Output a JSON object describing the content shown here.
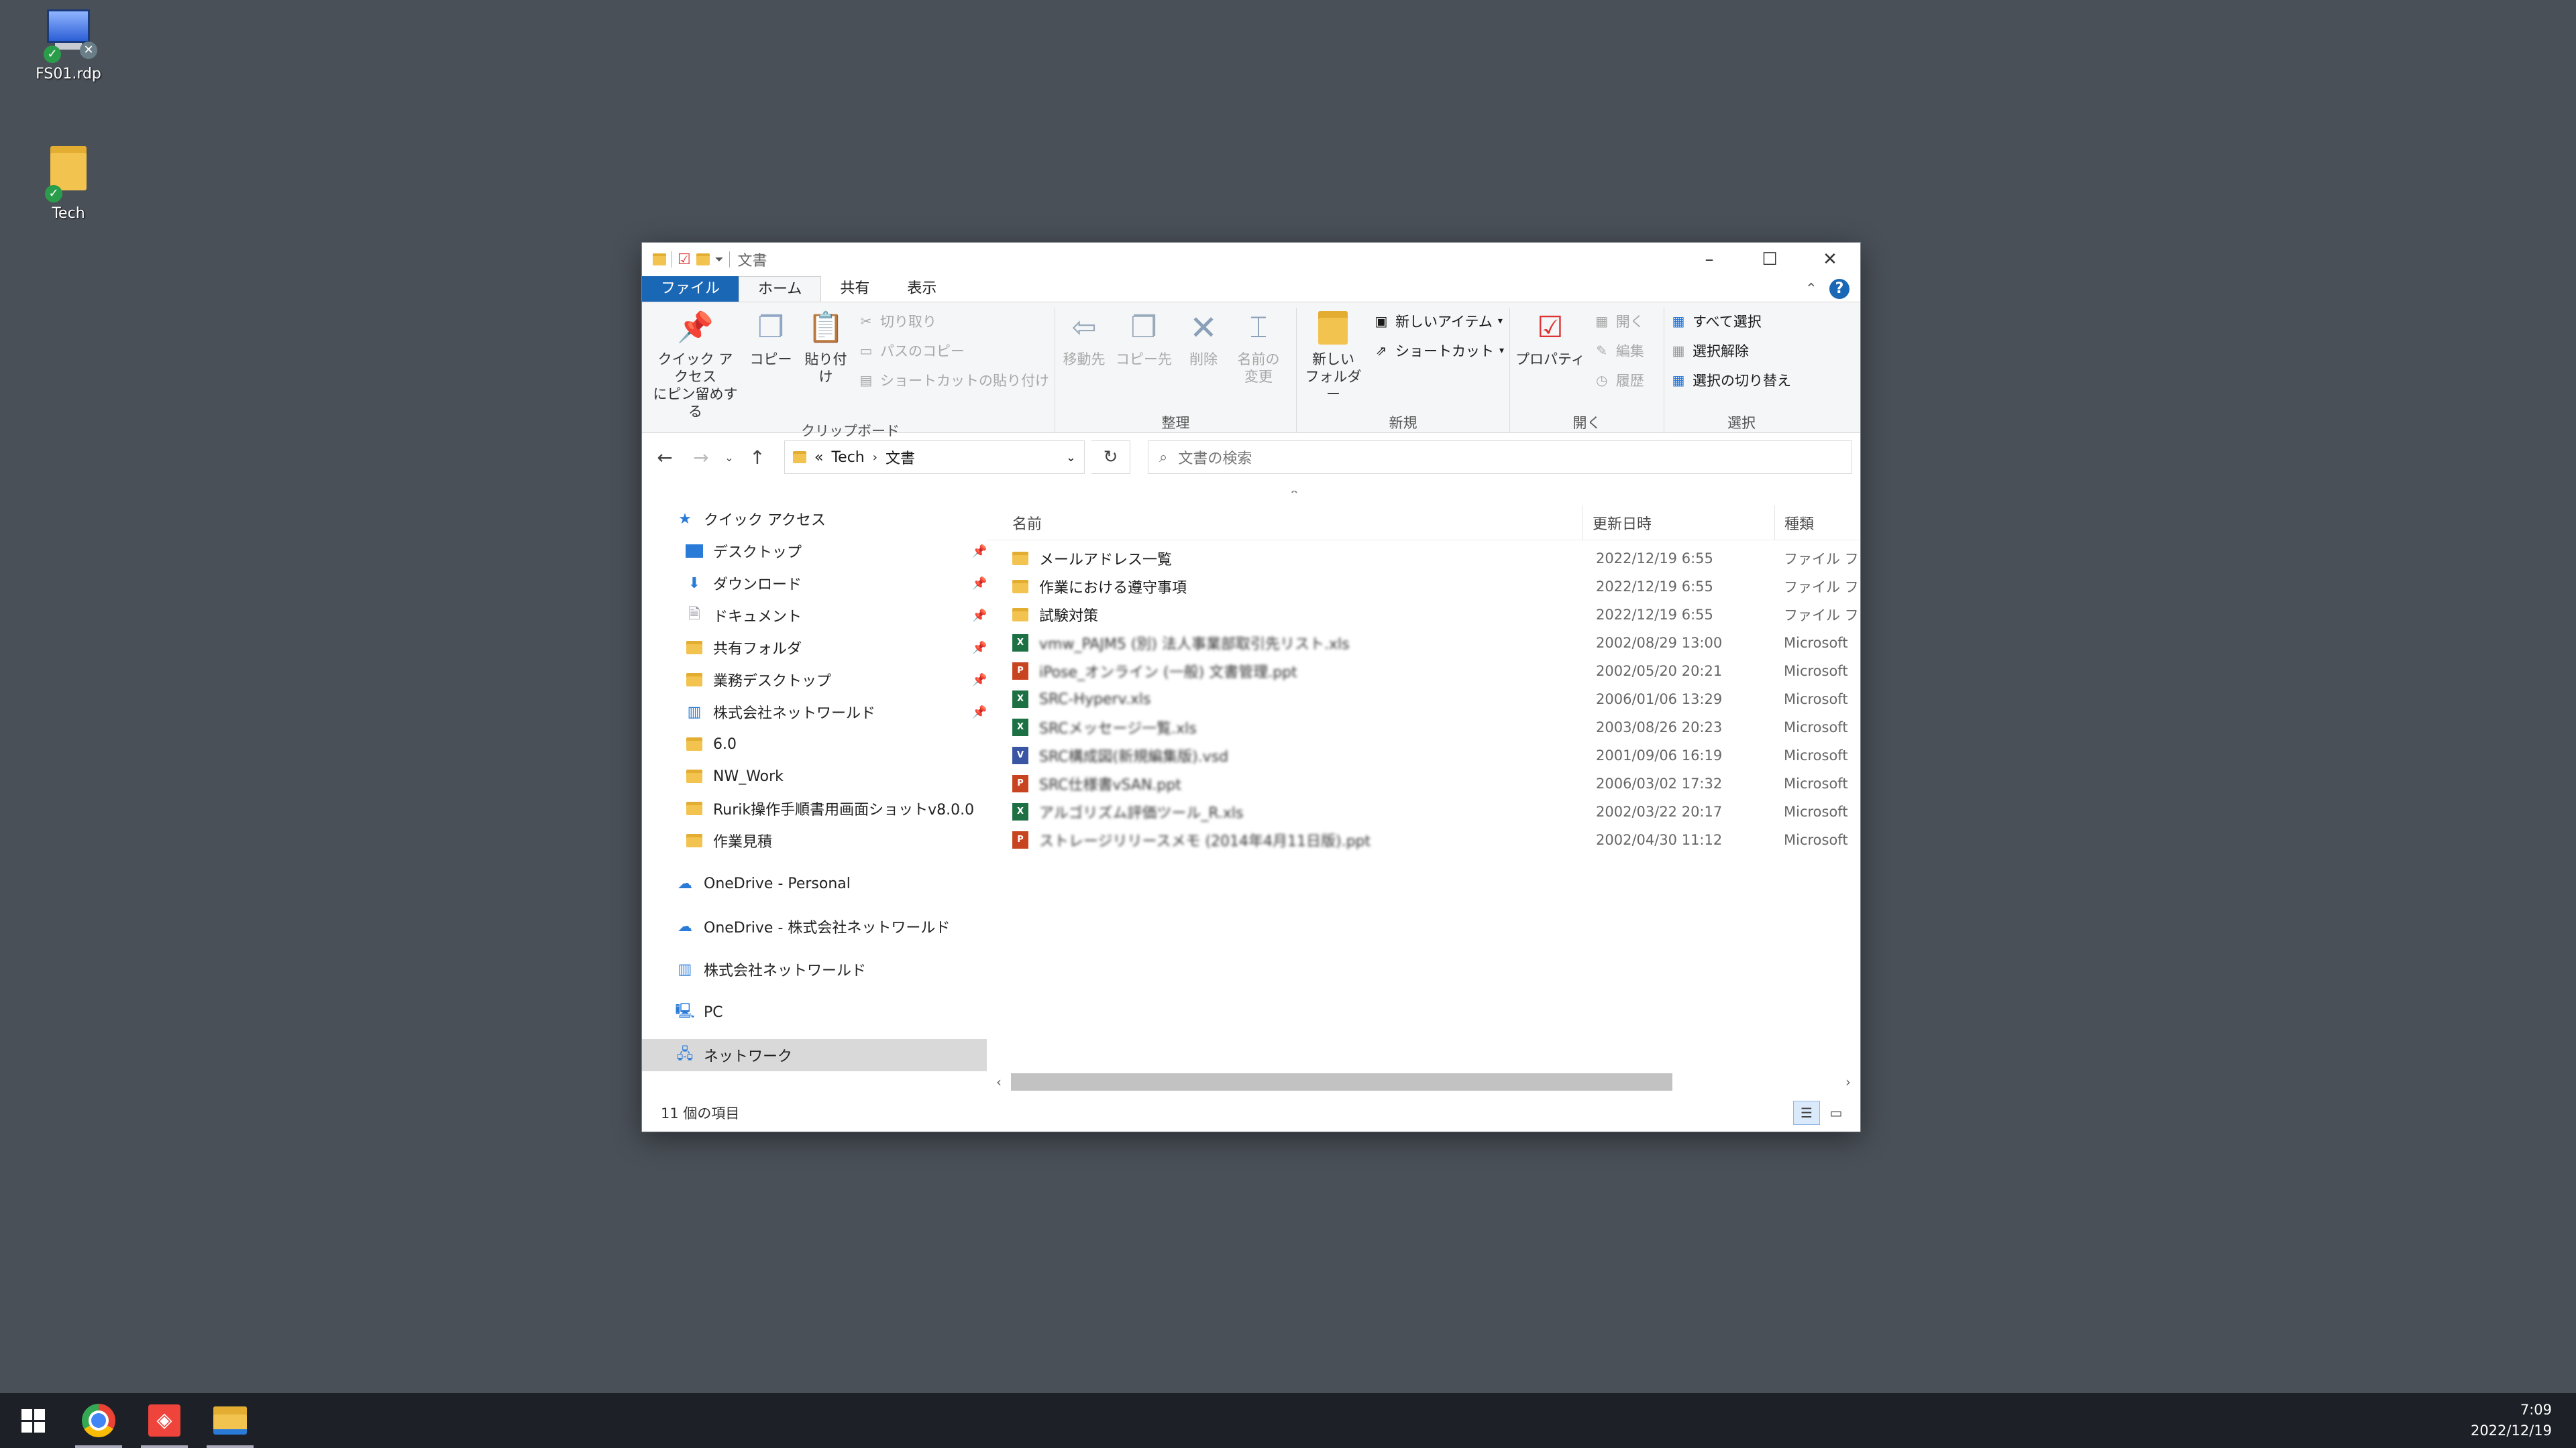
{
  "desktop": {
    "icons": [
      {
        "label": "FS01.rdp",
        "icon": "rdp-icon"
      },
      {
        "label": "Tech",
        "icon": "folder-icon"
      }
    ]
  },
  "window": {
    "title": "文書",
    "tabs": [
      "ファイル",
      "ホーム",
      "共有",
      "表示"
    ],
    "ribbon": {
      "clipboard": {
        "name": "クリップボード",
        "pin": "クイック アクセス\nにピン留めする",
        "copy": "コピー",
        "paste": "貼り付け",
        "cut": "切り取り",
        "copy_path": "パスのコピー",
        "paste_shortcut": "ショートカットの貼り付け"
      },
      "organize": {
        "name": "整理",
        "move_to": "移動先",
        "copy_to": "コピー先",
        "delete": "削除",
        "rename": "名前の\n変更"
      },
      "new": {
        "name": "新規",
        "new_folder": "新しい\nフォルダー",
        "new_item": "新しいアイテム",
        "shortcut": "ショートカット"
      },
      "open": {
        "name": "開く",
        "properties": "プロパティ",
        "open": "開く",
        "edit": "編集",
        "history": "履歴"
      },
      "select": {
        "name": "選択",
        "select_all": "すべて選択",
        "select_none": "選択解除",
        "invert": "選択の切り替え"
      }
    },
    "address": {
      "overflow": "«",
      "crumbs": [
        "Tech",
        "文書"
      ]
    },
    "search": {
      "placeholder": "文書の検索"
    },
    "nav": {
      "quick_access": "クイック アクセス",
      "pinned": [
        {
          "label": "デスクトップ",
          "icon": "desktop-icon"
        },
        {
          "label": "ダウンロード",
          "icon": "download-icon"
        },
        {
          "label": "ドキュメント",
          "icon": "document-icon"
        },
        {
          "label": "共有フォルダ",
          "icon": "folder-icon"
        },
        {
          "label": "業務デスクトップ",
          "icon": "folder-icon"
        },
        {
          "label": "株式会社ネットワールド",
          "icon": "building-icon"
        }
      ],
      "recent": [
        "6.0",
        "NW_Work",
        "Rurik操作手順書用画面ショットv8.0.0",
        "作業見積"
      ],
      "onedrive_personal": "OneDrive - Personal",
      "onedrive_org": "OneDrive - 株式会社ネットワールド",
      "org": "株式会社ネットワールド",
      "pc": "PC",
      "network": "ネットワーク"
    },
    "columns": {
      "name": "名前",
      "date": "更新日時",
      "type": "種類"
    },
    "files": [
      {
        "name": "メールアドレス一覧",
        "date": "2022/12/19 6:55",
        "type": "ファイル フォルダー",
        "kind": "folder"
      },
      {
        "name": "作業における遵守事項",
        "date": "2022/12/19 6:55",
        "type": "ファイル フォルダー",
        "kind": "folder"
      },
      {
        "name": "試験対策",
        "date": "2022/12/19 6:55",
        "type": "ファイル フォルダー",
        "kind": "folder"
      },
      {
        "name": "vmw_PAJM5 (別) 法人事業部取引先リスト.xls",
        "date": "2002/08/29 13:00",
        "type": "Microsoft",
        "kind": "xl",
        "blurred": true
      },
      {
        "name": "iPose_オンライン (一般) 文書管理.ppt",
        "date": "2002/05/20 20:21",
        "type": "Microsoft",
        "kind": "pp",
        "blurred": true
      },
      {
        "name": "SRC-Hyperv.xls",
        "date": "2006/01/06 13:29",
        "type": "Microsoft",
        "kind": "xl",
        "blurred": true
      },
      {
        "name": "SRCメッセージ一覧.xls",
        "date": "2003/08/26 20:23",
        "type": "Microsoft",
        "kind": "xl",
        "blurred": true
      },
      {
        "name": "SRC構成図(新規編集版).vsd",
        "date": "2001/09/06 16:19",
        "type": "Microsoft",
        "kind": "vs",
        "blurred": true
      },
      {
        "name": "SRC仕様書vSAN.ppt",
        "date": "2006/03/02 17:32",
        "type": "Microsoft",
        "kind": "pp",
        "blurred": true
      },
      {
        "name": "アルゴリズム評価ツール_R.xls",
        "date": "2002/03/22 20:17",
        "type": "Microsoft",
        "kind": "xl",
        "blurred": true
      },
      {
        "name": "ストレージリリースメモ (2014年4月11日版).ppt",
        "date": "2002/04/30 11:12",
        "type": "Microsoft",
        "kind": "pp",
        "blurred": true
      }
    ],
    "status": "11 個の項目"
  },
  "taskbar": {
    "time": "7:09",
    "date": "2022/12/19"
  }
}
